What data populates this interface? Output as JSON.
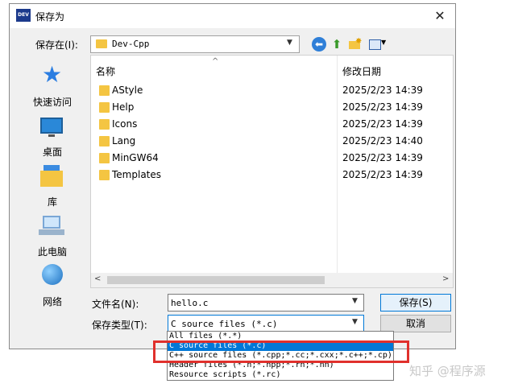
{
  "window": {
    "title": "保存为",
    "app_icon_text": "DEV",
    "close_glyph": "✕"
  },
  "location": {
    "label": "保存在(I):",
    "value": "Dev-Cpp"
  },
  "toolbar": {
    "back_glyph": "⬅",
    "up_glyph": "⬆",
    "newfolder_spark": "✸"
  },
  "places": [
    {
      "label": "快速访问"
    },
    {
      "label": "桌面"
    },
    {
      "label": "库"
    },
    {
      "label": "此电脑"
    },
    {
      "label": "网络"
    }
  ],
  "filelist": {
    "columns": {
      "name": "名称",
      "date": "修改日期"
    },
    "rows": [
      {
        "name": "AStyle",
        "date": "2025/2/23 14:39"
      },
      {
        "name": "Help",
        "date": "2025/2/23 14:39"
      },
      {
        "name": "Icons",
        "date": "2025/2/23 14:39"
      },
      {
        "name": "Lang",
        "date": "2025/2/23 14:40"
      },
      {
        "name": "MinGW64",
        "date": "2025/2/23 14:39"
      },
      {
        "name": "Templates",
        "date": "2025/2/23 14:39"
      }
    ]
  },
  "form": {
    "filename_label": "文件名(N):",
    "filename_value": "hello.c",
    "type_label": "保存类型(T):",
    "type_value": "C source files (*.c)",
    "save_label": "保存(S)",
    "cancel_label": "取消"
  },
  "dropdown": {
    "options": [
      "All files (*.*)",
      "C source files (*.c)",
      "C++ source files (*.cpp;*.cc;*.cxx;*.c++;*.cp)",
      "Header files (*.h;*.hpp;*.rh;*.hh)",
      "Resource scripts (*.rc)"
    ],
    "selected_index": 1
  },
  "watermark": "知乎 @程序源",
  "colors": {
    "selection": "#0078d7",
    "highlight_box": "#e0302c"
  }
}
